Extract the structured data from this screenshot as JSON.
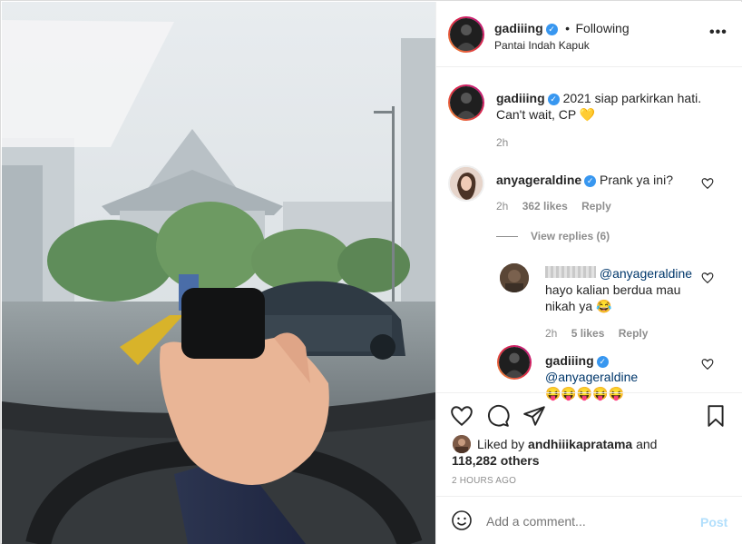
{
  "post": {
    "username": "gadiiing",
    "follow_status": "Following",
    "location": "Pantai Indah Kapuk"
  },
  "caption": {
    "username": "gadiiing",
    "text": "2021 siap parkirkan hati. Can't wait, CP",
    "emoji": "💛",
    "time": "2h"
  },
  "comment1": {
    "username": "anyageraldine",
    "text": "Prank ya ini?",
    "time": "2h",
    "likes": "362 likes",
    "reply": "Reply",
    "view_replies": "View replies (6)"
  },
  "reply1": {
    "mention": "@anyageraldine",
    "text": "hayo kalian berdua mau nikah ya",
    "emoji": "😂",
    "time": "2h",
    "likes": "5 likes",
    "reply": "Reply"
  },
  "reply2": {
    "username": "gadiiing",
    "mention": "@anyageraldine",
    "emojis": "😝😝😝😝😝"
  },
  "likes_section": {
    "liked_by_prefix": "Liked by",
    "liked_by_user": "andhiiikapratama",
    "and": "and",
    "others": "118,282 others",
    "timestamp": "2 HOURS AGO"
  },
  "comment_box": {
    "placeholder": "Add a comment...",
    "post_label": "Post"
  },
  "colors": {
    "verified": "#3897f0",
    "link_blue": "#00376b",
    "post_disabled": "#b2dffc"
  }
}
